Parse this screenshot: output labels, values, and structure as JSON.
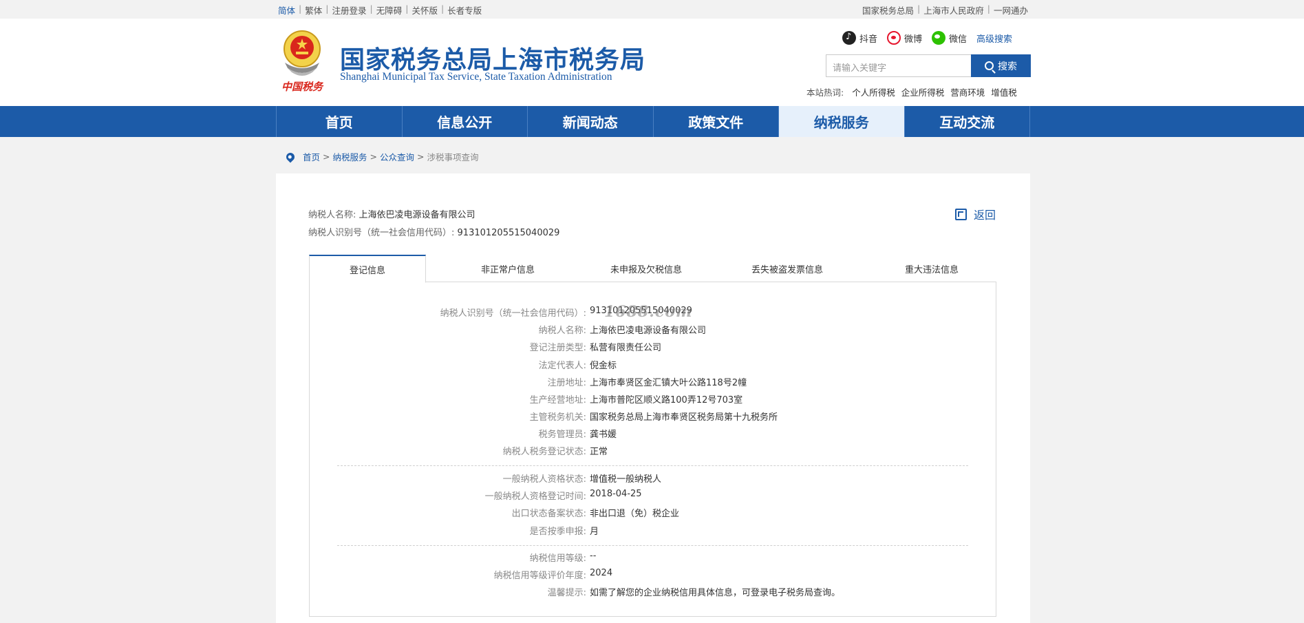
{
  "topbar": {
    "left_links": [
      "简体",
      "繁体",
      "注册登录",
      "无障碍",
      "关怀版",
      "长者专版"
    ],
    "right_links": [
      "国家税务总局",
      "上海市人民政府",
      "一网通办"
    ]
  },
  "header": {
    "title_cn": "国家税务总局上海市税务局",
    "title_en": "Shanghai Municipal Tax Service, State Taxation Administration",
    "emblem_text": "中国税务",
    "social": {
      "douyin": "抖音",
      "weibo": "微博",
      "wechat": "微信",
      "advanced_search": "高级搜索"
    },
    "search": {
      "placeholder": "请输入关键字",
      "button": "搜索"
    },
    "hot": {
      "label": "本站热词:",
      "keywords": [
        "个人所得税",
        "企业所得税",
        "营商环境",
        "增值税"
      ]
    }
  },
  "nav": {
    "items": [
      "首页",
      "信息公开",
      "新闻动态",
      "政策文件",
      "纳税服务",
      "互动交流"
    ],
    "active_index": 4
  },
  "breadcrumb": {
    "items": [
      "首页",
      "纳税服务",
      "公众查询"
    ],
    "current": "涉税事项查询",
    "sep": ">"
  },
  "taxpayer": {
    "name_label": "纳税人名称:",
    "name": "上海依巴凌电源设备有限公司",
    "id_label": "纳税人识别号（统一社会信用代码）:",
    "id": "913101205515040029"
  },
  "back_label": "返回",
  "tabs": {
    "items": [
      "登记信息",
      "非正常户信息",
      "未申报及欠税信息",
      "丢失被盗发票信息",
      "重大违法信息"
    ],
    "active_index": 0
  },
  "watermark": "1688.com",
  "detail": {
    "group1": [
      {
        "label": "纳税人识别号（统一社会信用代码）:",
        "value": "913101205515040029"
      },
      {
        "label": "纳税人名称:",
        "value": "上海依巴凌电源设备有限公司"
      },
      {
        "label": "登记注册类型:",
        "value": "私营有限责任公司"
      },
      {
        "label": "法定代表人:",
        "value": "倪金标"
      },
      {
        "label": "注册地址:",
        "value": "上海市奉贤区金汇镇大叶公路118号2幢"
      },
      {
        "label": "生产经营地址:",
        "value": "上海市普陀区顺义路100弄12号703室"
      },
      {
        "label": "主管税务机关:",
        "value": "国家税务总局上海市奉贤区税务局第十九税务所"
      },
      {
        "label": "税务管理员:",
        "value": "龚书媛"
      },
      {
        "label": "纳税人税务登记状态:",
        "value": "正常"
      }
    ],
    "group2": [
      {
        "label": "一般纳税人资格状态:",
        "value": "增值税一般纳税人"
      },
      {
        "label": "一般纳税人资格登记时间:",
        "value": "2018-04-25"
      },
      {
        "label": "出口状态备案状态:",
        "value": "非出口退（免）税企业"
      },
      {
        "label": "是否按季申报:",
        "value": "月"
      }
    ],
    "group3": [
      {
        "label": "纳税信用等级:",
        "value": "--"
      },
      {
        "label": "纳税信用等级评价年度:",
        "value": "2024"
      },
      {
        "label": "温馨提示:",
        "value": "如需了解您的企业纳税信用具体信息，可登录电子税务局查询。"
      }
    ]
  },
  "colors": {
    "brand_blue": "#1c5ba8",
    "nav_active_bg": "#e6f0fb",
    "page_bg": "#f2f2f2"
  }
}
